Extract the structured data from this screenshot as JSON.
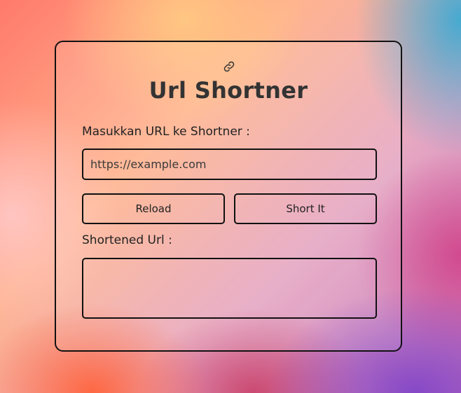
{
  "card": {
    "icon": "link-icon",
    "title": "Url Shortner"
  },
  "form": {
    "input_label": "Masukkan URL ke Shortner :",
    "input_placeholder": "https://example.com",
    "input_value": "",
    "reload_label": "Reload",
    "short_label": "Short It",
    "output_label": "Shortened Url :",
    "output_value": ""
  },
  "colors": {
    "text": "#333333",
    "border": "#111111"
  }
}
